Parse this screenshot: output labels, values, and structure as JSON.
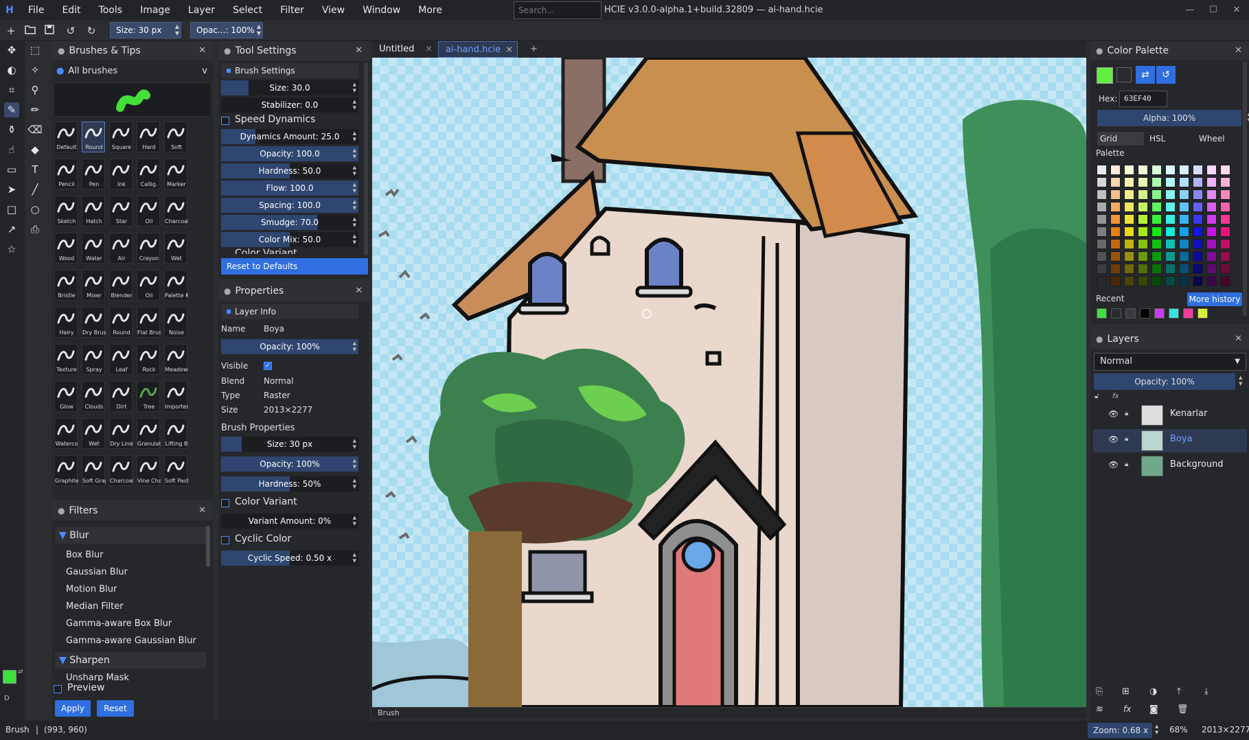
{
  "menubar": {
    "logo": "H",
    "items": [
      "File",
      "Edit",
      "Tools",
      "Image",
      "Layer",
      "Select",
      "Filter",
      "View",
      "Window",
      "More"
    ],
    "search_placeholder": "Search...",
    "window_title": "HCIE v3.0.0-alpha.1+build.32809 — ai-hand.hcie"
  },
  "toolbar": {
    "size_label": "Size: 30 px",
    "opacity_label": "Opac...: 100%"
  },
  "brushes_panel": {
    "title": "Brushes & Tips",
    "category": "All brushes",
    "dropdown_arrow": "v",
    "brushes": [
      [
        "Default",
        "Round",
        "Square",
        "Hard",
        "Soft"
      ],
      [
        "Pencil",
        "Pen",
        "Ink",
        "Callig.",
        "Marker"
      ],
      [
        "Sketch",
        "Hatch",
        "Star",
        "Oil",
        "Charcoal"
      ],
      [
        "Wood",
        "Water",
        "Air",
        "Crayon",
        "Wet"
      ],
      [
        "Bristle",
        "Mixer",
        "Blender",
        "Oil",
        "Palette K"
      ],
      [
        "Hairy",
        "Dry Brush",
        "Round",
        "Flat Brus",
        "Noise"
      ],
      [
        "Texture",
        "Spray",
        "Leaf",
        "Rock",
        "Meadow"
      ],
      [
        "Glow",
        "Clouds",
        "Dirt",
        "Tree",
        "Imported"
      ],
      [
        "Waterco",
        "Wet",
        "Dry Line",
        "Granulati",
        "Lifting B"
      ],
      [
        "Graphite",
        "Soft Grap",
        "Charcoal",
        "Vine Char",
        "Soft Past"
      ]
    ]
  },
  "filters_panel": {
    "title": "Filters",
    "groups": [
      {
        "name": "Blur",
        "items": [
          "Box Blur",
          "Gaussian Blur",
          "Motion Blur",
          "Median Filter",
          "Gamma-aware Box Blur",
          "Gamma-aware Gaussian Blur"
        ]
      },
      {
        "name": "Sharpen",
        "items": [
          "Unsharp Mask"
        ]
      }
    ],
    "preview_label": "Preview",
    "apply_label": "Apply",
    "reset_label": "Reset"
  },
  "tool_settings": {
    "title": "Tool Settings",
    "brush_settings": "Brush Settings",
    "size": "Size: 30.0",
    "stabilizer": "Stabilizer: 0.0",
    "speed_dynamics": "Speed Dynamics",
    "dynamics_amount": "Dynamics Amount: 25.0",
    "opacity": "Opacity: 100.0",
    "hardness": "Hardness: 50.0",
    "flow": "Flow: 100.0",
    "spacing": "Spacing: 100.0",
    "smudge": "Smudge: 70.0",
    "color_mix": "Color Mix: 50.0",
    "color_variant_cut": "Color Variant",
    "reset_defaults": "Reset to Defaults"
  },
  "properties": {
    "title": "Properties",
    "layer_info": "Layer Info",
    "name_label": "Name",
    "name_value": "Boya",
    "opacity": "Opacity: 100%",
    "visible_label": "Visible",
    "blend_label": "Blend",
    "blend_value": "Normal",
    "type_label": "Type",
    "type_value": "Raster",
    "size_label": "Size",
    "size_value": "2013×2277",
    "brush_properties": "Brush Properties",
    "bp_size": "Size: 30 px",
    "bp_opacity": "Opacity: 100%",
    "bp_hardness": "Hardness: 50%",
    "color_variant": "Color Variant",
    "variant_amount": "Variant Amount: 0%",
    "cyclic_color": "Cyclic Color",
    "cyclic_speed": "Cyclic Speed: 0.50 x"
  },
  "tabs": {
    "tab1": "Untitled",
    "tab2": "ai-hand.hcie",
    "close": "×",
    "add": "+"
  },
  "canvas": {
    "bottom_label": "Brush"
  },
  "color_palette": {
    "title": "Color Palette",
    "hex_label": "Hex:",
    "hex_value": "63EF40",
    "alpha": "Alpha: 100%",
    "tabs": [
      "Grid",
      "HSL",
      "Wheel"
    ],
    "palette_label": "Palette",
    "recent_label": "Recent",
    "more_history": "More history",
    "primary_color": "#63ef40",
    "recent_colors": [
      "#3fe03f",
      "#2a2b2f",
      "#3a3b40",
      "#000000",
      "#c83cf0",
      "#3ce0e0",
      "#f03c9a",
      "#d8f03c"
    ]
  },
  "layers": {
    "title": "Layers",
    "blend_mode": "Normal",
    "opacity": "Opacity: 100%",
    "items": [
      {
        "name": "Kenarlar",
        "selected": false
      },
      {
        "name": "Boya",
        "selected": true
      },
      {
        "name": "Background",
        "selected": false
      }
    ]
  },
  "statusbar": {
    "tool": "Brush",
    "separator": "|",
    "coords": "(993, 960)",
    "zoom": "Zoom: 0.68 x",
    "zoom_pct": "68%",
    "doc_size": "2013×2277"
  },
  "color_chip": {
    "fg": "#3fe03f",
    "default_label": "D"
  }
}
